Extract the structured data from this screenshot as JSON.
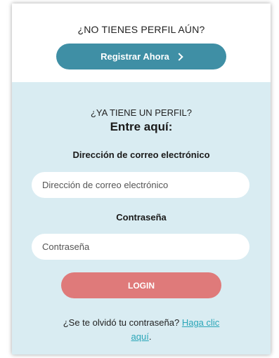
{
  "register": {
    "heading": "¿NO TIENES PERFIL AÚN?",
    "button_label": "Registrar Ahora",
    "button_icon": "chevron-right-icon",
    "button_color": "#3f8fa5"
  },
  "login": {
    "subheading": "¿YA TIENE UN PERFIL?",
    "heading": "Entre aquí:",
    "email_label": "Dirección de correo electrónico",
    "email_placeholder": "Dirección de correo electrónico",
    "password_label": "Contraseña",
    "password_placeholder": "Contraseña",
    "login_label": "LOGIN",
    "login_color": "#df7a7a",
    "forgot_text": "¿Se te olvidó tu contraseña?",
    "forgot_link": "Haga clic aquí",
    "forgot_suffix": ".",
    "background_color": "#d9ecf2"
  }
}
